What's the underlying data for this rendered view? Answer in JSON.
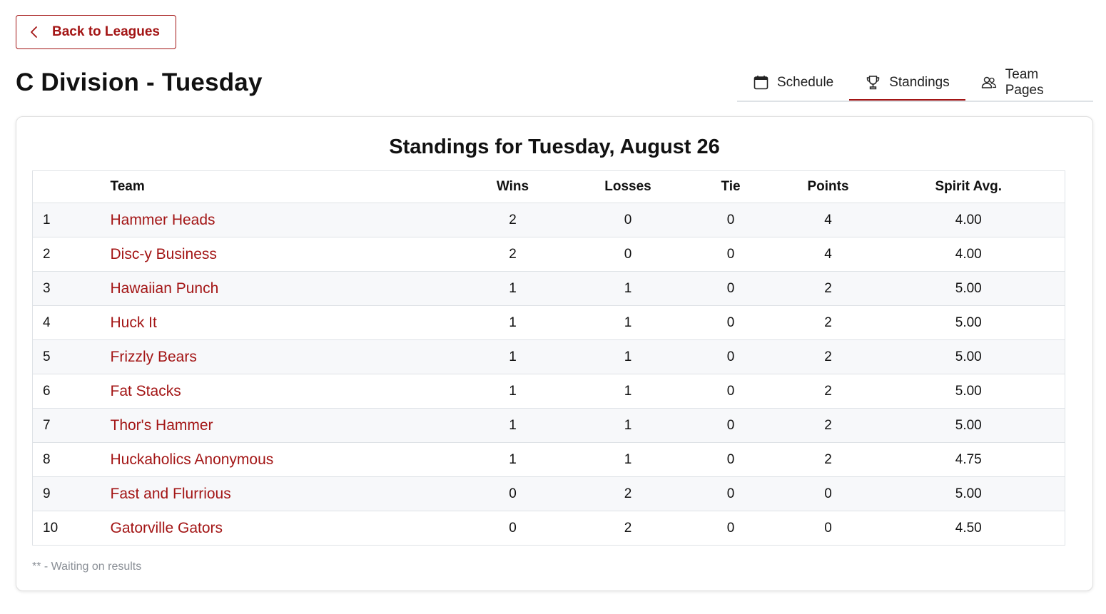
{
  "back_button": {
    "label": "Back to Leagues",
    "icon": "chevron-left-icon"
  },
  "page_title": "C Division - Tuesday",
  "tabs": [
    {
      "label": "Schedule",
      "icon": "calendar-icon",
      "active": false
    },
    {
      "label": "Standings",
      "icon": "trophy-icon",
      "active": true
    },
    {
      "label": "Team Pages",
      "icon": "people-icon",
      "active": false
    }
  ],
  "standings": {
    "title": "Standings for Tuesday, August 26",
    "columns": {
      "rank": "",
      "team": "Team",
      "wins": "Wins",
      "losses": "Losses",
      "tie": "Tie",
      "points": "Points",
      "spirit": "Spirit Avg."
    },
    "rows": [
      {
        "rank": "1",
        "team": "Hammer Heads",
        "wins": "2",
        "losses": "0",
        "tie": "0",
        "points": "4",
        "spirit": "4.00"
      },
      {
        "rank": "2",
        "team": "Disc-y Business",
        "wins": "2",
        "losses": "0",
        "tie": "0",
        "points": "4",
        "spirit": "4.00"
      },
      {
        "rank": "3",
        "team": "Hawaiian Punch",
        "wins": "1",
        "losses": "1",
        "tie": "0",
        "points": "2",
        "spirit": "5.00"
      },
      {
        "rank": "4",
        "team": "Huck It",
        "wins": "1",
        "losses": "1",
        "tie": "0",
        "points": "2",
        "spirit": "5.00"
      },
      {
        "rank": "5",
        "team": "Frizzly Bears",
        "wins": "1",
        "losses": "1",
        "tie": "0",
        "points": "2",
        "spirit": "5.00"
      },
      {
        "rank": "6",
        "team": "Fat Stacks",
        "wins": "1",
        "losses": "1",
        "tie": "0",
        "points": "2",
        "spirit": "5.00"
      },
      {
        "rank": "7",
        "team": "Thor's Hammer",
        "wins": "1",
        "losses": "1",
        "tie": "0",
        "points": "2",
        "spirit": "5.00"
      },
      {
        "rank": "8",
        "team": "Huckaholics Anonymous",
        "wins": "1",
        "losses": "1",
        "tie": "0",
        "points": "2",
        "spirit": "4.75"
      },
      {
        "rank": "9",
        "team": "Fast and Flurrious",
        "wins": "0",
        "losses": "2",
        "tie": "0",
        "points": "0",
        "spirit": "5.00"
      },
      {
        "rank": "10",
        "team": "Gatorville Gators",
        "wins": "0",
        "losses": "2",
        "tie": "0",
        "points": "0",
        "spirit": "4.50"
      }
    ],
    "footnote": "** - Waiting on results"
  },
  "colors": {
    "accent": "#a31515",
    "stripe": "#f7f8fa",
    "border": "#dee2e6",
    "muted": "#8a8f96"
  }
}
